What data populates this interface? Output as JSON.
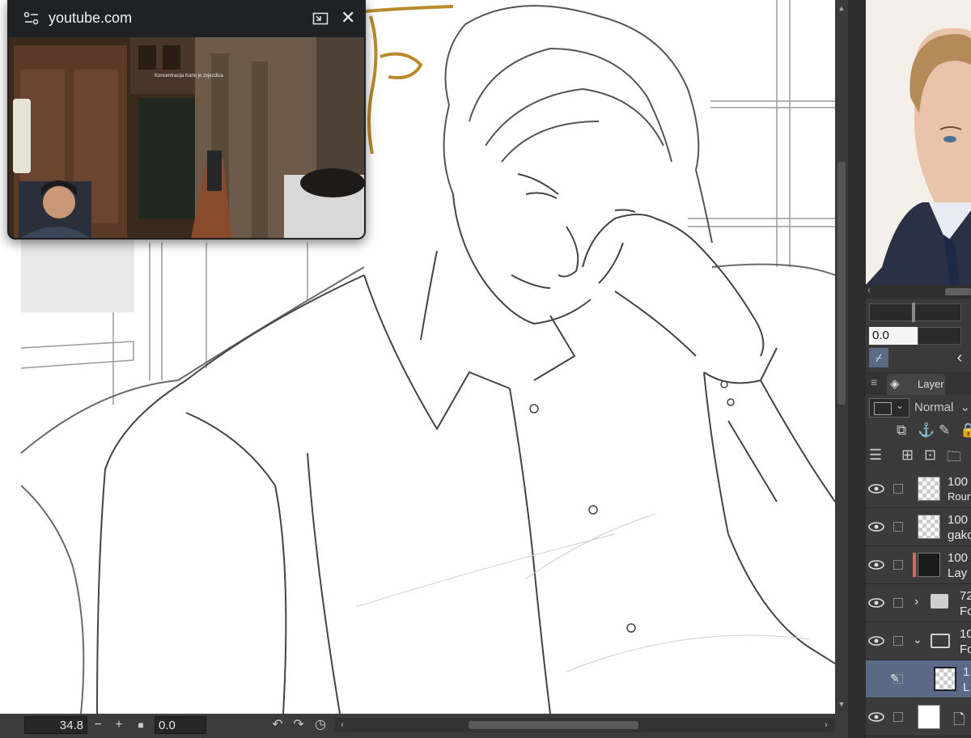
{
  "pip": {
    "site": "youtube.com",
    "hud_text": "Koncentracija    Karlo je zvjezdica"
  },
  "statusbar": {
    "zoom": "34.8",
    "zoom_out": "−",
    "zoom_in": "+",
    "angle": "0.0"
  },
  "right_panel": {
    "brush_value": "0.0",
    "layer_tab": "Layer",
    "blend_mode": "Normal",
    "layers": [
      {
        "opacity": "100",
        "name": "Roun",
        "type": "raster"
      },
      {
        "opacity": "100",
        "name": "gako",
        "type": "raster"
      },
      {
        "opacity": "100",
        "name": "Lay",
        "type": "dark"
      },
      {
        "opacity": "72",
        "name": "Fo",
        "type": "folder"
      },
      {
        "opacity": "10",
        "name": "Fo",
        "type": "folder-open"
      },
      {
        "opacity": "1",
        "name": "L",
        "type": "selected"
      },
      {
        "opacity": "",
        "name": "",
        "type": "paper"
      }
    ]
  },
  "colors": {
    "panel_bg": "#3a3a3a",
    "selected_layer": "#5a6a86",
    "canvas": "#ffffff",
    "layer_color_tag": "#e06060"
  }
}
